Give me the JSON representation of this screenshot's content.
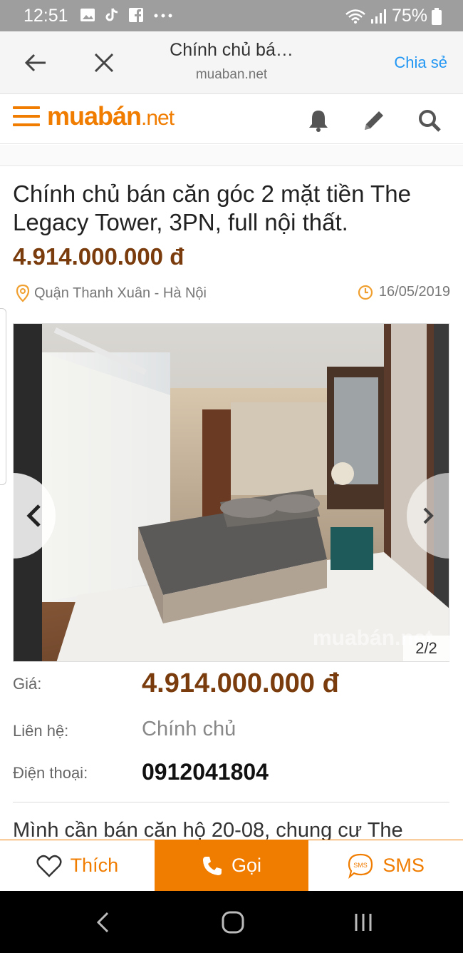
{
  "status_bar": {
    "time": "12:51",
    "battery": "75%",
    "icons": [
      "gallery-icon",
      "tiktok-icon",
      "facebook-icon",
      "more-dots-icon",
      "wifi-icon",
      "signal-icon",
      "battery-icon"
    ]
  },
  "browser": {
    "page_title": "Chính chủ bá…",
    "url": "muaban.net",
    "share_label": "Chia sẻ"
  },
  "site": {
    "logo_main": "muabán",
    "logo_tld": ".net",
    "brand_color": "#f07c00"
  },
  "listing": {
    "title": "Chính chủ bán căn góc 2 mặt tiền The Legacy Tower, 3PN, full nội thất.",
    "price": "4.914.000.000 đ",
    "location": "Quận Thanh Xuân - Hà Nội",
    "date": "16/05/2019",
    "photo_counter": "2/2",
    "photo_watermark": "muabán.net",
    "price_color": "#7a3c0c"
  },
  "details": {
    "price_label": "Giá:",
    "price_value": "4.914.000.000 đ",
    "contact_label": "Liên hệ:",
    "contact_value": "Chính chủ",
    "phone_label": "Điện thoại:",
    "phone_value": "0912041804"
  },
  "description_preview": "Mình cần bán căn hộ 20-08, chung cư The",
  "actions": {
    "like_label": "Thích",
    "call_label": "Gọi",
    "sms_label": "SMS",
    "sms_icon_text": "SMS"
  }
}
